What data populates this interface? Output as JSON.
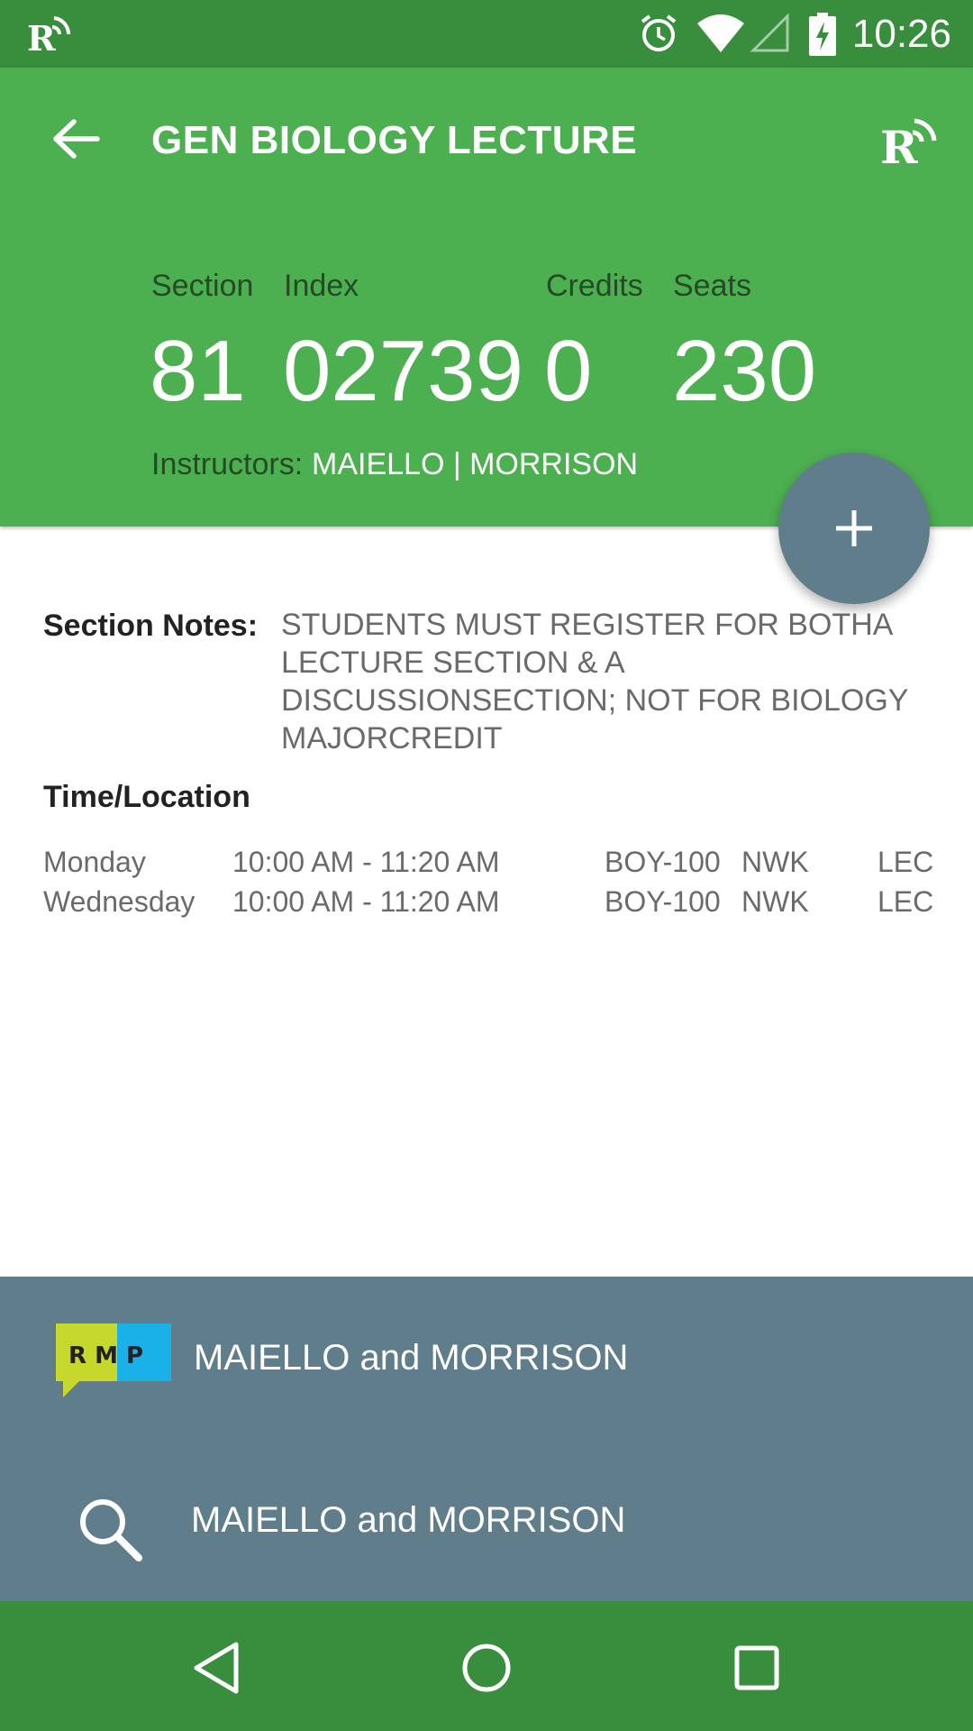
{
  "status_bar": {
    "time": "10:26",
    "icons": [
      "app-notification-icon",
      "alarm-icon",
      "wifi-icon",
      "signal-icon",
      "battery-charging-icon"
    ]
  },
  "header": {
    "title": "GEN BIOLOGY LECTURE",
    "back_icon": "arrow-back-icon",
    "logo_icon": "rutgers-logo-icon",
    "color": "#4caf50"
  },
  "stats": {
    "section_label": "Section",
    "section_value": "81",
    "index_label": "Index",
    "index_value": "02739",
    "credits_label": "Credits",
    "credits_value": "0",
    "seats_label": "Seats",
    "seats_value": "230"
  },
  "instructors": {
    "label": "Instructors:",
    "value": "MAIELLO | MORRISON"
  },
  "fab": {
    "icon": "plus-icon",
    "color": "#607d8b"
  },
  "notes": {
    "label": "Section Notes:",
    "text": "STUDENTS MUST REGISTER FOR BOTHA LECTURE SECTION & A DISCUSSIONSECTION; NOT FOR BIOLOGY MAJORCREDIT"
  },
  "time_location": {
    "header": "Time/Location",
    "rows": [
      {
        "day": "Monday",
        "time": "10:00 AM - 11:20 AM",
        "room": "BOY-100",
        "campus": "NWK",
        "type": "LEC"
      },
      {
        "day": "Wednesday",
        "time": "10:00 AM - 11:20 AM",
        "room": "BOY-100",
        "campus": "NWK",
        "type": "LEC"
      }
    ]
  },
  "bottom_panel": {
    "color": "#607d8b",
    "rmp_label": "MAIELLO and MORRISON",
    "rmp_logo_text": "R M P",
    "search_label": "MAIELLO and MORRISON"
  },
  "nav_bar": {
    "color": "#388e3c",
    "buttons": [
      "back-triangle-icon",
      "home-circle-icon",
      "recents-square-icon"
    ]
  }
}
